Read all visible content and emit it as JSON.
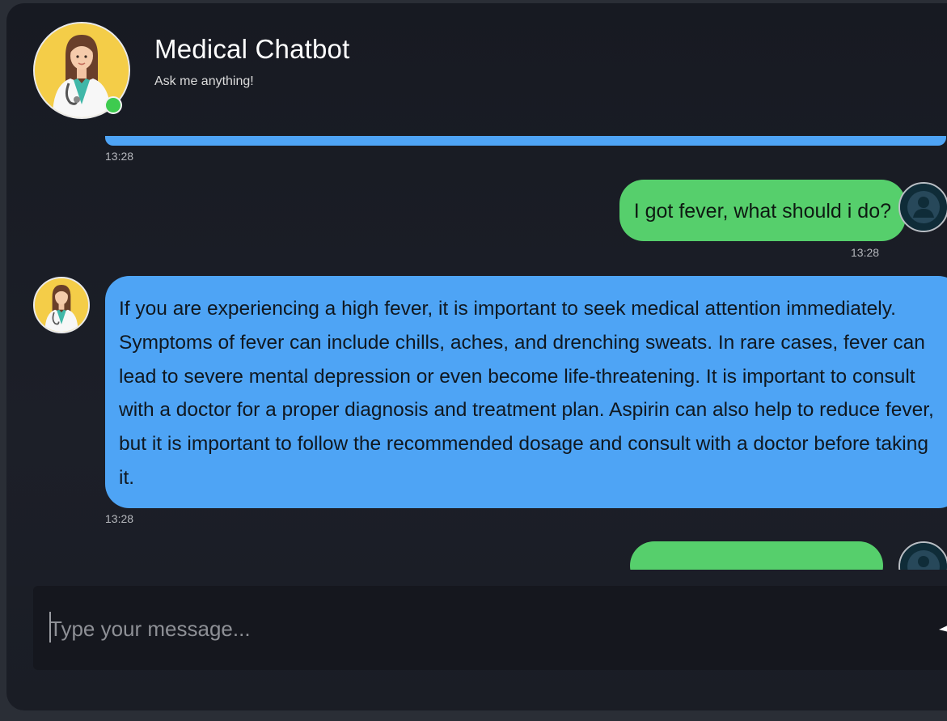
{
  "header": {
    "title": "Medical Chatbot",
    "subtitle": "Ask me anything!",
    "status": "online"
  },
  "messages": [
    {
      "sender": "bot",
      "text": "",
      "time": "13:28"
    },
    {
      "sender": "user",
      "text": "I got fever, what should i do?",
      "time": "13:28"
    },
    {
      "sender": "bot",
      "text": "If you are experiencing a high fever, it is important to seek medical attention immediately. Symptoms of fever can include chills, aches, and drenching sweats. In rare cases, fever can lead to severe mental depression or even become life-threatening. It is important to consult with a doctor for a proper diagnosis and treatment plan. Aspirin can also help to reduce fever, but it is important to follow the recommended dosage and consult with a doctor before taking it.",
      "time": "13:28"
    },
    {
      "sender": "user",
      "text": "",
      "time": ""
    }
  ],
  "composer": {
    "placeholder": "Type your message...",
    "value": "",
    "send_icon": "send-icon"
  },
  "colors": {
    "bot_bubble": "#4ea4f5",
    "user_bubble": "#56cf6c",
    "online": "#3ecb4f",
    "background": "#1b1e27"
  },
  "icons": {
    "bot_avatar": "doctor-avatar-icon",
    "user_avatar": "user-avatar-icon"
  }
}
